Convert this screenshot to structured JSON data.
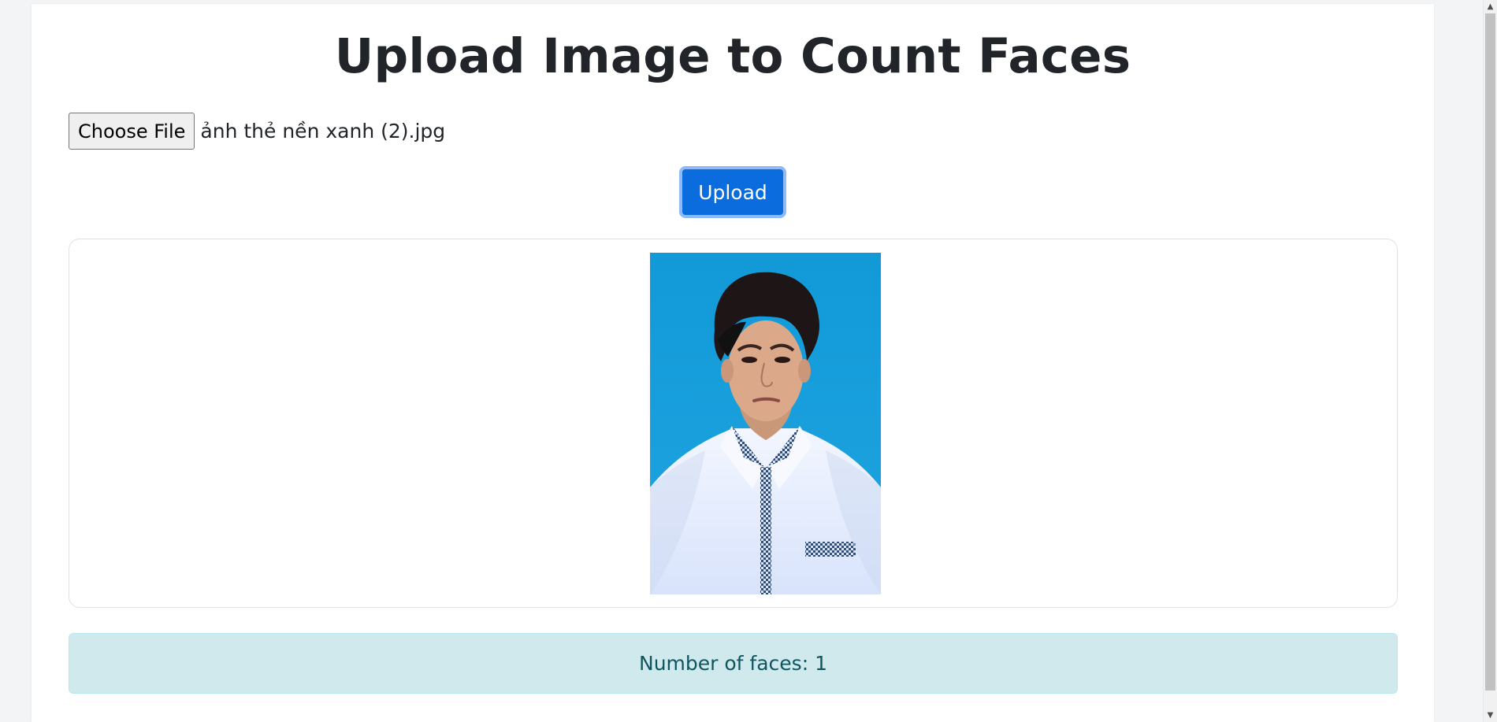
{
  "page": {
    "title": "Upload Image to Count Faces"
  },
  "upload_form": {
    "choose_file_label": "Choose File",
    "selected_file": "ảnh thẻ nền xanh (2).jpg",
    "upload_label": "Upload"
  },
  "image_preview": {
    "background_color": "#129ad9"
  },
  "result": {
    "text": "Number of faces: 1",
    "background_color": "#cfe9ed",
    "text_color": "#0f5560"
  },
  "colors": {
    "primary_button": "#0b6cde",
    "page_text": "#212529"
  },
  "icons": {
    "scroll_up": "scroll-up-arrow-icon",
    "scroll_down": "scroll-down-arrow-icon"
  }
}
